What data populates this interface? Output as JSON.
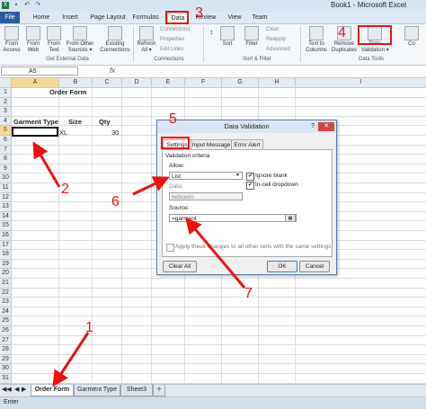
{
  "window": {
    "title": "Book1 - Microsoft Excel"
  },
  "tabs": [
    "File",
    "Home",
    "Insert",
    "Page Layout",
    "Formulas",
    "Data",
    "Review",
    "View",
    "Team"
  ],
  "ribbon": {
    "get_external": [
      {
        "label": "From\nAccess"
      },
      {
        "label": "From\nWeb"
      },
      {
        "label": "From\nText"
      },
      {
        "label": "From Other\nSources ▾"
      },
      {
        "label": "Existing\nConnections"
      }
    ],
    "get_external_label": "Get External Data",
    "connections": {
      "refresh": "Refresh\nAll ▾",
      "items": [
        "Connections",
        "Properties",
        "Edit Links"
      ],
      "label": "Connections"
    },
    "sort_filter": {
      "sort": "Sort",
      "filter": "Filter",
      "items": [
        "Clear",
        "Reapply",
        "Advanced"
      ],
      "label": "Sort & Filter"
    },
    "tools": {
      "items": [
        "Text to\nColumns",
        "Remove\nDuplicates",
        "Data\nValidation ▾",
        "Co"
      ],
      "label": "Data Tools"
    }
  },
  "formula_bar": {
    "name_box": "A5",
    "fx": "fx",
    "value": ""
  },
  "columns": [
    "A",
    "B",
    "C",
    "D",
    "E",
    "F",
    "G",
    "H",
    "I"
  ],
  "rows": [
    "1",
    "2",
    "3",
    "4",
    "5",
    "6",
    "7",
    "8",
    "9",
    "10",
    "11",
    "12",
    "13",
    "14",
    "15",
    "16",
    "17",
    "18",
    "19",
    "20",
    "21",
    "22",
    "23",
    "24",
    "25",
    "26",
    "27",
    "28",
    "29",
    "30",
    "31"
  ],
  "cells": {
    "title": "Order Form",
    "garment": "Garment Type",
    "size": "Size",
    "qty": "Qty",
    "b5": "XL",
    "c5": "30"
  },
  "sheets": [
    "Order Form",
    "Garment Type",
    "Sheet3"
  ],
  "status": "Enter",
  "dialog": {
    "title": "Data Validation",
    "help": "?",
    "close": "✕",
    "tabs": [
      "Settings",
      "Input Message",
      "Error Alert"
    ],
    "criteria": "Validation criteria",
    "allow_label": "Allow:",
    "allow_value": "List",
    "data_label": "Data:",
    "data_value": "between",
    "ignore_blank": "Ignore blank",
    "in_cell_dropdown": "In-cell dropdown",
    "source_label": "Source:",
    "source_value": "=garment",
    "apply_text": "Apply these changes to all other cells with the same settings",
    "clear": "Clear All",
    "ok": "OK",
    "cancel": "Cancel"
  },
  "annotations": [
    "1",
    "2",
    "3",
    "4",
    "5",
    "6",
    "7"
  ],
  "colors": {
    "accent": "#2a5d9e",
    "annotation": "#e11111"
  }
}
